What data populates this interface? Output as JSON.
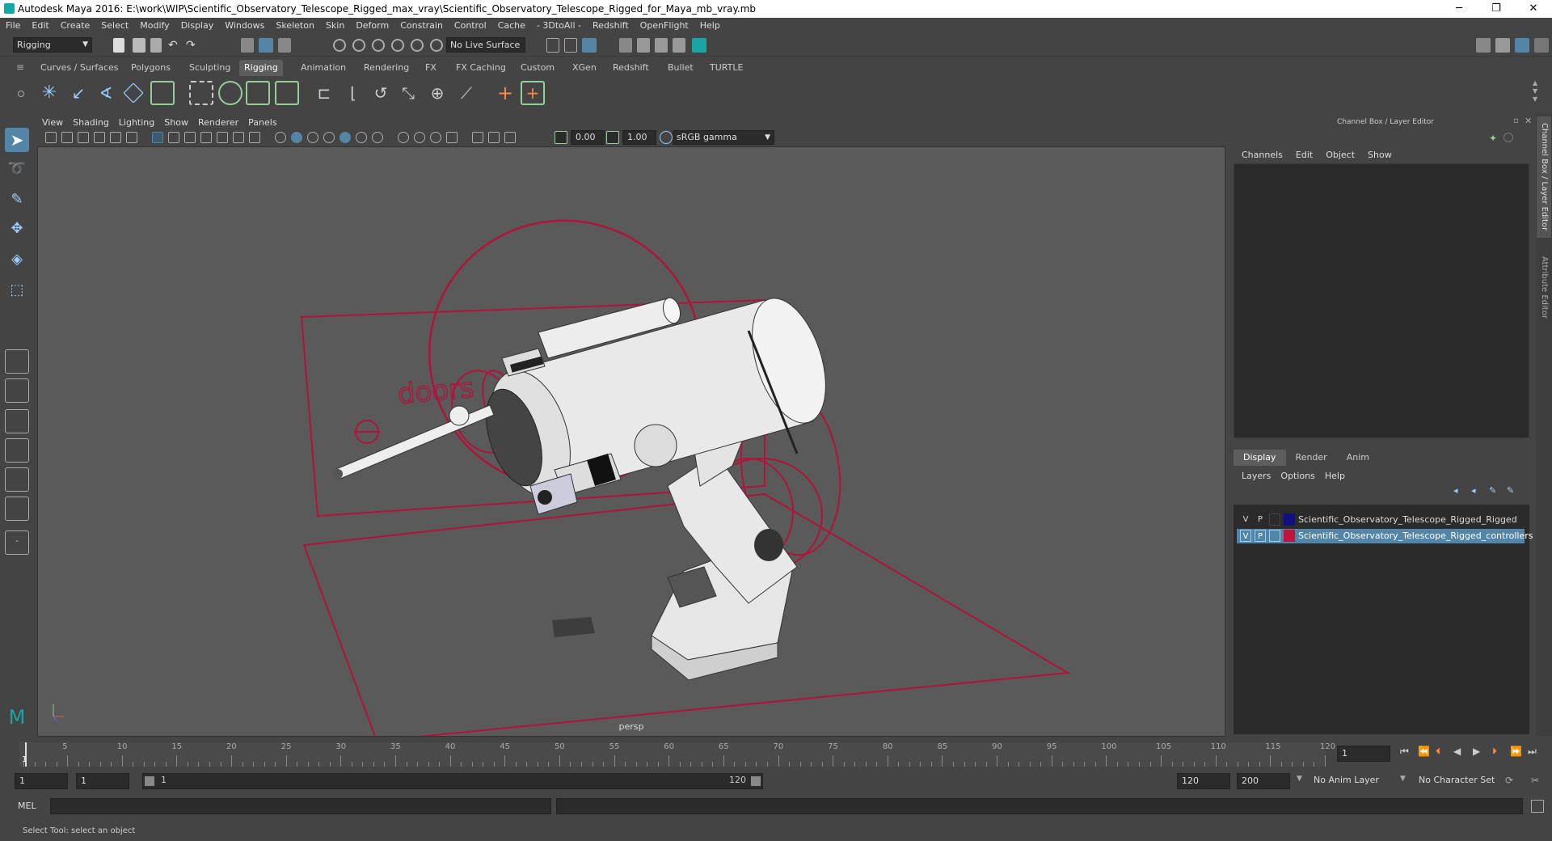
{
  "window": {
    "title": "Autodesk Maya 2016: E:\\work\\WIP\\Scientific_Observatory_Telescope_Rigged_max_vray\\Scientific_Observatory_Telescope_Rigged_for_Maya_mb_vray.mb",
    "minimize": "─",
    "maximize": "❐",
    "close": "✕"
  },
  "menubar": [
    "File",
    "Edit",
    "Create",
    "Select",
    "Modify",
    "Display",
    "Windows",
    "Skeleton",
    "Skin",
    "Deform",
    "Constrain",
    "Control",
    "Cache",
    "- 3DtoAll -",
    "Redshift",
    "OpenFlight",
    "Help"
  ],
  "statusline": {
    "mode": "Rigging",
    "live_surface": "No Live Surface"
  },
  "shelf_tabs": [
    "Curves / Surfaces",
    "Polygons",
    "Sculpting",
    "Rigging",
    "Animation",
    "Rendering",
    "FX",
    "FX Caching",
    "Custom",
    "XGen",
    "Redshift",
    "Bullet",
    "TURTLE"
  ],
  "active_shelf": "Rigging",
  "viewport": {
    "menu": [
      "View",
      "Shading",
      "Lighting",
      "Show",
      "Renderer",
      "Panels"
    ],
    "exposure": "0.00",
    "gamma": "1.00",
    "colorspace": "sRGB gamma",
    "camera": "persp",
    "label_doors": "doors"
  },
  "channel_box": {
    "title": "Channel Box / Layer Editor",
    "menu": [
      "Channels",
      "Edit",
      "Object",
      "Show"
    ],
    "layer_tabs": [
      "Display",
      "Render",
      "Anim"
    ],
    "active_layer_tab": "Display",
    "layer_menu": [
      "Layers",
      "Options",
      "Help"
    ],
    "layers": [
      {
        "v": "V",
        "p": "P",
        "color": "#101080",
        "name": "Scientific_Observatory_Telescope_Rigged_Rigged",
        "selected": false
      },
      {
        "v": "V",
        "p": "P",
        "color": "#c0143c",
        "name": "Scientific_Observatory_Telescope_Rigged_controllers",
        "selected": true
      }
    ]
  },
  "side_tabs": [
    "Channel Box / Layer Editor",
    "Attribute Editor"
  ],
  "timeline": {
    "ticks": [
      "5",
      "10",
      "15",
      "20",
      "25",
      "30",
      "35",
      "40",
      "45",
      "50",
      "55",
      "60",
      "65",
      "70",
      "75",
      "80",
      "85",
      "90",
      "95",
      "100",
      "105",
      "110",
      "115",
      "120"
    ],
    "current_frame_marker": "1",
    "current_frame": "1"
  },
  "range": {
    "start": "1",
    "playback_start": "1",
    "slider_start": "1",
    "slider_end": "120",
    "playback_end": "120",
    "end": "200",
    "anim_layer": "No Anim Layer",
    "character_set": "No Character Set"
  },
  "command": {
    "label": "MEL"
  },
  "help": {
    "text": "Select Tool: select an object"
  },
  "colors": {
    "accent_teal": "#1aa5a5",
    "selection_blue": "#5285a6",
    "controller_red": "#b0143c"
  }
}
